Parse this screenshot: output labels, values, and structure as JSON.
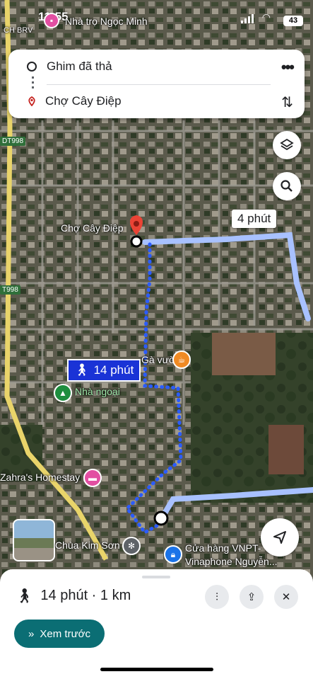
{
  "status": {
    "time": "11:55",
    "back_label": "CH BRV",
    "battery": "43"
  },
  "route": {
    "from": "Ghim đã thả",
    "to": "Chợ Cây Điệp"
  },
  "map": {
    "labels": {
      "nha_tro": "Nhà trọ Ngọc Minh",
      "cho": "Chợ Cây Điệp",
      "ga_vuon": "Gà vườn",
      "nha_ngoai": "Nhà ngoại",
      "zahra": "Zahra's Homestay",
      "chua": "Chùa Kim Sơn",
      "vnpt_1": "Cửa hàng VNPT-",
      "vnpt_2": "Vinaphone Nguyễn...",
      "dt998_a": "DT998",
      "dt998_b": "T998"
    },
    "drive_time": "4 phút",
    "walk_time": "14 phút"
  },
  "sheet": {
    "summary": "14 phút · 1 km",
    "preview": "Xem trước"
  },
  "colors": {
    "accent": "#0b6e74",
    "walk": "#1a33d6",
    "route": "#a8c1ff"
  }
}
